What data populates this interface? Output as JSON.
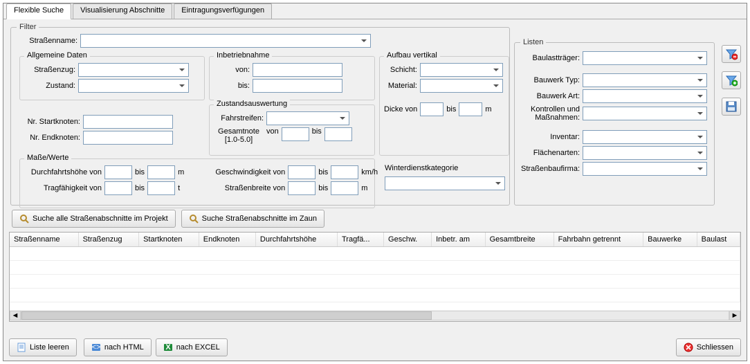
{
  "tabs": [
    "Flexible Suche",
    "Visualisierung Abschnitte",
    "Eintragungsverfügungen"
  ],
  "filter": {
    "legend": "Filter",
    "strassenname_label": "Straßenname:",
    "allg": {
      "title": "Allgemeine Daten",
      "strassenzug": "Straßenzug:",
      "zustand": "Zustand:"
    },
    "nr_start": "Nr. Startknoten:",
    "nr_end": "Nr. Endknoten:",
    "inb": {
      "title": "Inbetriebnahme",
      "von": "von:",
      "bis": "bis:"
    },
    "zustand_a": {
      "title": "Zustandsauswertung",
      "fahrstreifen": "Fahrstreifen:",
      "gesamtnote": "Gesamtnote",
      "range": "[1.0-5.0]",
      "von": "von",
      "bis": "bis"
    },
    "vert": {
      "title": "Aufbau vertikal",
      "schicht": "Schicht:",
      "material": "Material:",
      "dicke_von": "Dicke von",
      "bis": "bis",
      "unit_m": "m",
      "winter": "Winterdienstkategorie"
    },
    "masse": {
      "title": "Maße/Werte",
      "durchfahrt": "Durchfahrtshöhe von",
      "trag": "Tragfähigkeit von",
      "geschw": "Geschwindigkeit von",
      "strbr": "Straßenbreite von",
      "bis": "bis",
      "unit_m": "m",
      "unit_t": "t",
      "unit_kmh": "km/h"
    }
  },
  "listen": {
    "legend": "Listen",
    "baulasttraeger": "Baulastträger:",
    "bauwerk_typ": "Bauwerk Typ:",
    "bauwerk_art": "Bauwerk Art:",
    "kontrollen": "Kontrollen und Maßnahmen:",
    "inventar": "Inventar:",
    "flaechenarten": "Flächenarten:",
    "strassenbaufirma": "Straßenbaufirma:"
  },
  "buttons": {
    "search_all": "Suche alle Straßenabschnitte im Projekt",
    "search_fence": "Suche Straßenabschnitte im Zaun",
    "clear": "Liste leeren",
    "html": "nach HTML",
    "excel": "nach EXCEL",
    "close": "Schliessen"
  },
  "table_headers": [
    "Straßenname",
    "Straßenzug",
    "Startknoten",
    "Endknoten",
    "Durchfahrtshöhe",
    "Tragfä...",
    "Geschw.",
    "Inbetr. am",
    "Gesamtbreite",
    "Fahrbahn getrennt",
    "Bauwerke",
    "Baulast"
  ]
}
